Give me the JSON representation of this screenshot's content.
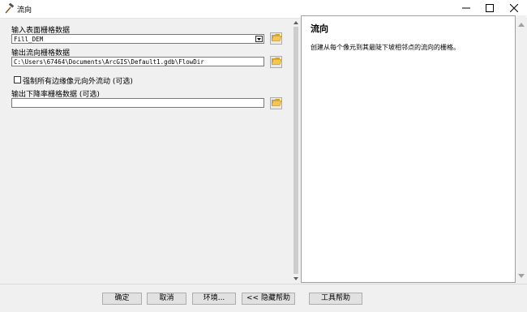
{
  "window": {
    "title": "流向",
    "icon": "hammer-tool-icon",
    "controls": [
      "minimize-icon",
      "maximize-icon",
      "close-icon"
    ]
  },
  "form": {
    "input_raster_label": "输入表面栅格数据",
    "input_raster_value": "Fill_DEM",
    "output_raster_label": "输出流向栅格数据",
    "output_raster_value": "C:\\Users\\67464\\Documents\\ArcGIS\\Default1.gdb\\FlowDir",
    "force_edge_label": "强制所有边缘像元向外流动 (可选)",
    "force_edge_checked": false,
    "drop_raster_label": "输出下降率栅格数据 (可选)",
    "drop_raster_value": ""
  },
  "help": {
    "title": "流向",
    "text": "创建从每个像元到其最陡下坡相邻点的流向的栅格。"
  },
  "buttons": {
    "ok": "确定",
    "cancel": "取消",
    "env": "环境...",
    "hide_help": "<< 隐藏帮助",
    "tool_help": "工具帮助"
  }
}
